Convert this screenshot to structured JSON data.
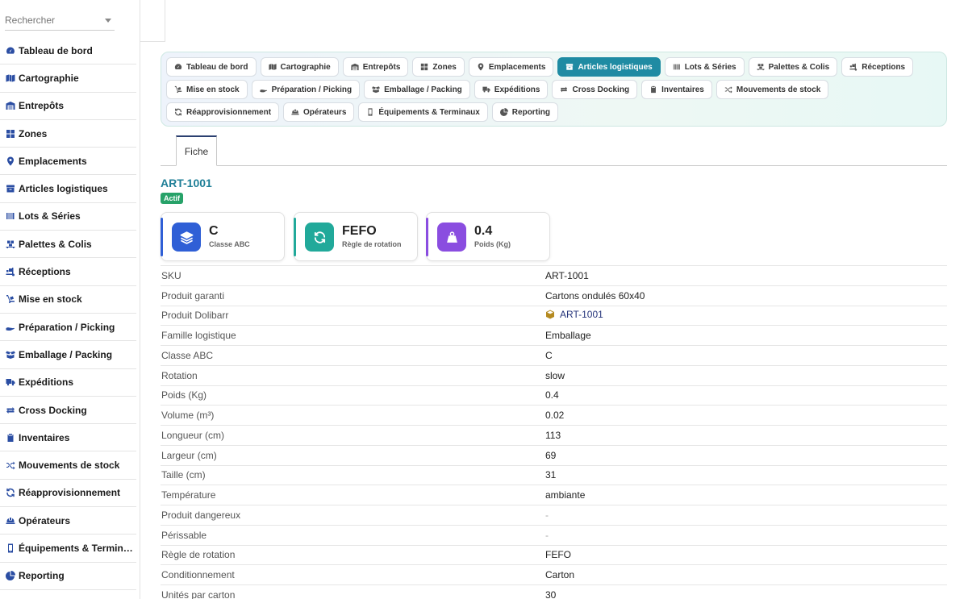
{
  "sidebar": {
    "search": {
      "placeholder": "Rechercher"
    },
    "items": [
      {
        "label": "Tableau de bord",
        "icon": "gauge-icon"
      },
      {
        "label": "Cartographie",
        "icon": "map-icon"
      },
      {
        "label": "Entrepôts",
        "icon": "warehouse-icon"
      },
      {
        "label": "Zones",
        "icon": "grid-icon"
      },
      {
        "label": "Emplacements",
        "icon": "map-pin-icon"
      },
      {
        "label": "Articles logistiques",
        "icon": "box-icon"
      },
      {
        "label": "Lots & Séries",
        "icon": "barcode-icon"
      },
      {
        "label": "Palettes & Colis",
        "icon": "pallet-icon"
      },
      {
        "label": "Réceptions",
        "icon": "truck-loading-icon"
      },
      {
        "label": "Mise en stock",
        "icon": "dolly-icon"
      },
      {
        "label": "Préparation / Picking",
        "icon": "hand-icon"
      },
      {
        "label": "Emballage / Packing",
        "icon": "box-open-icon"
      },
      {
        "label": "Expéditions",
        "icon": "truck-icon"
      },
      {
        "label": "Cross Docking",
        "icon": "exchange-icon"
      },
      {
        "label": "Inventaires",
        "icon": "clipboard-check-icon"
      },
      {
        "label": "Mouvements de stock",
        "icon": "shuffle-icon"
      },
      {
        "label": "Réapprovisionnement",
        "icon": "sync-icon"
      },
      {
        "label": "Opérateurs",
        "icon": "hard-hat-icon"
      },
      {
        "label": "Équipements & Terminaux",
        "icon": "mobile-icon"
      },
      {
        "label": "Reporting",
        "icon": "pie-chart-icon"
      }
    ]
  },
  "tabs": {
    "active_index": 5,
    "items": [
      {
        "label": "Tableau de bord",
        "icon": "gauge-icon"
      },
      {
        "label": "Cartographie",
        "icon": "map-icon"
      },
      {
        "label": "Entrepôts",
        "icon": "warehouse-icon"
      },
      {
        "label": "Zones",
        "icon": "grid-icon"
      },
      {
        "label": "Emplacements",
        "icon": "map-pin-icon"
      },
      {
        "label": "Articles logistiques",
        "icon": "box-icon"
      },
      {
        "label": "Lots & Séries",
        "icon": "barcode-icon"
      },
      {
        "label": "Palettes & Colis",
        "icon": "pallet-icon"
      },
      {
        "label": "Réceptions",
        "icon": "truck-loading-icon"
      },
      {
        "label": "Mise en stock",
        "icon": "dolly-icon"
      },
      {
        "label": "Préparation / Picking",
        "icon": "hand-icon"
      },
      {
        "label": "Emballage / Packing",
        "icon": "box-open-icon"
      },
      {
        "label": "Expéditions",
        "icon": "truck-icon"
      },
      {
        "label": "Cross Docking",
        "icon": "exchange-icon"
      },
      {
        "label": "Inventaires",
        "icon": "clipboard-check-icon"
      },
      {
        "label": "Mouvements de stock",
        "icon": "shuffle-icon"
      },
      {
        "label": "Réapprovisionnement",
        "icon": "sync-icon"
      },
      {
        "label": "Opérateurs",
        "icon": "hard-hat-icon"
      },
      {
        "label": "Équipements & Terminaux",
        "icon": "mobile-icon"
      },
      {
        "label": "Reporting",
        "icon": "pie-chart-icon"
      }
    ]
  },
  "content_tab": {
    "label": "Fiche"
  },
  "record": {
    "title": "ART-1001",
    "status": "Actif",
    "status_color": "#27a269"
  },
  "kpis": [
    {
      "value": "C",
      "label": "Classe ABC",
      "icon": "layers-icon",
      "color": "#2f5fd6"
    },
    {
      "value": "FEFO",
      "label": "Règle de rotation",
      "icon": "sync-icon",
      "color": "#21a99a"
    },
    {
      "value": "0.4",
      "label": "Poids (Kg)",
      "icon": "weight-icon",
      "color": "#8a4de0"
    }
  ],
  "details": [
    {
      "label": "SKU",
      "value": "ART-1001"
    },
    {
      "label": "Produit garanti",
      "value": "Cartons ondulés 60x40"
    },
    {
      "label": "Produit Dolibarr",
      "value": "ART-1001",
      "link": true,
      "icon": "cube-icon"
    },
    {
      "label": "Famille logistique",
      "value": "Emballage"
    },
    {
      "label": "Classe ABC",
      "value": "C"
    },
    {
      "label": "Rotation",
      "value": "slow"
    },
    {
      "label": "Poids (Kg)",
      "value": "0.4"
    },
    {
      "label": "Volume (m³)",
      "value": "0.02"
    },
    {
      "label": "Longueur (cm)",
      "value": "113"
    },
    {
      "label": "Largeur (cm)",
      "value": "69"
    },
    {
      "label": "Taille (cm)",
      "value": "31"
    },
    {
      "label": "Température",
      "value": "ambiante"
    },
    {
      "label": "Produit dangereux",
      "value": "-"
    },
    {
      "label": "Périssable",
      "value": "-"
    },
    {
      "label": "Règle de rotation",
      "value": "FEFO"
    },
    {
      "label": "Conditionnement",
      "value": "Carton"
    },
    {
      "label": "Unités par carton",
      "value": "30"
    }
  ],
  "colors": {
    "accent": "#1f8ba3",
    "link": "#24337a",
    "title": "#1f7f97",
    "nav_icon": "#2b4ea3"
  }
}
